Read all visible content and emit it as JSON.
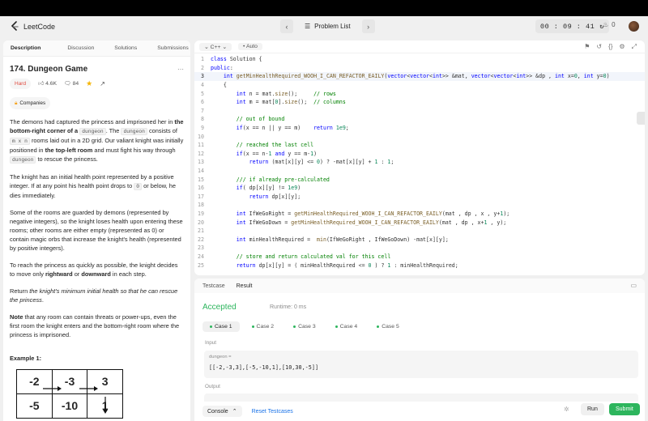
{
  "nav": {
    "brand": "LeetCode",
    "problem_list_label": "Problem List",
    "timer": "00 : 09 : 41",
    "streak_count": "0"
  },
  "left_tabs": [
    "Description",
    "Discussion",
    "Solutions",
    "Submissions"
  ],
  "problem": {
    "title": "174. Dungeon Game",
    "difficulty": "Hard",
    "likes": "4.6K",
    "comments": "84",
    "companies_label": "Companies",
    "p1_a": "The demons had captured the princess and imprisoned her in ",
    "p1_b": "the bottom-right corner of a ",
    "p1_code1": "dungeon",
    "p1_c": ". The ",
    "p1_code2": "dungeon",
    "p1_d": " consists of ",
    "p1_code3": "m x n",
    "p1_e": " rooms laid out in a 2D grid. Our valiant knight was initially positioned in ",
    "p1_f": "the top-left room",
    "p1_g": " and must fight his way through ",
    "p1_code4": "dungeon",
    "p1_h": " to rescue the princess.",
    "p2_a": "The knight has an initial health point represented by a positive integer. If at any point his health point drops to ",
    "p2_code": "0",
    "p2_b": " or below, he dies immediately.",
    "p3": "Some of the rooms are guarded by demons (represented by negative integers), so the knight loses health upon entering these rooms; other rooms are either empty (represented as 0) or contain magic orbs that increase the knight's health (represented by positive integers).",
    "p4_a": "To reach the princess as quickly as possible, the knight decides to move only ",
    "p4_b": "rightward",
    "p4_c": " or ",
    "p4_d": "downward",
    "p4_e": " in each step.",
    "p5_a": "Return ",
    "p5_b": "the knight's minimum initial health so that he can rescue the princess",
    "p5_c": ".",
    "p6_a": "Note",
    "p6_b": " that any room can contain threats or power-ups, even the first room the knight enters and the bottom-right room where the princess is imprisoned.",
    "example_label": "Example 1:",
    "grid": [
      [
        "-2",
        "-3",
        "3"
      ],
      [
        "-5",
        "-10",
        "1"
      ]
    ]
  },
  "editor": {
    "language": "C++",
    "mode": "Auto",
    "current_line": 3
  },
  "code_lines": [
    "class Solution {",
    "public:",
    "    int getMinHealthRequired_WOOH_I_CAN_REFACTOR_EAILY(vector<vector<int>> &mat, vector<vector<int>> &dp , int x=0, int y=0)",
    "    {",
    "        int n = mat.size();     // rows",
    "        int m = mat[0].size();  // columns",
    "",
    "        // out of bound",
    "        if(x == n || y == m)    return 1e9;",
    "",
    "        // reached the last cell",
    "        if(x == n-1 and y == m-1)",
    "            return (mat[x][y] <= 0) ? -mat[x][y] + 1 : 1;",
    "",
    "        /// if already pre-calculated",
    "        if( dp[x][y] != 1e9)",
    "            return dp[x][y];",
    "",
    "        int IfWeGoRight = getMinHealthRequired_WOOH_I_CAN_REFACTOR_EAILY(mat , dp , x , y+1);",
    "        int IfWeGoDown = getMinHealthRequired_WOOH_I_CAN_REFACTOR_EAILY(mat , dp , x+1 , y);",
    "",
    "        int minHealthRequired =  min(IfWeGoRight , IfWeGoDown) -mat[x][y];",
    "",
    "        // store and return calculated val for this cell",
    "        return dp[x][y] = ( minHealthRequired <= 0 ) ? 1 : minHealthRequired;"
  ],
  "test": {
    "tab_testcase": "Testcase",
    "tab_result": "Result",
    "status": "Accepted",
    "runtime": "Runtime: 0 ms",
    "cases": [
      "Case 1",
      "Case 2",
      "Case 3",
      "Case 4",
      "Case 5"
    ],
    "input_label": "Input",
    "var_name": "dungeon =",
    "input_value": "[[-2,-3,3],[-5,-10,1],[10,30,-5]]",
    "output_label": "Output"
  },
  "bottom_bar": {
    "console": "Console",
    "reset": "Reset Testcases",
    "run": "Run",
    "submit": "Submit"
  },
  "colors": {
    "accepted": "#2db55d",
    "hard": "#e04a3f",
    "submit_bg": "#2db55d"
  }
}
